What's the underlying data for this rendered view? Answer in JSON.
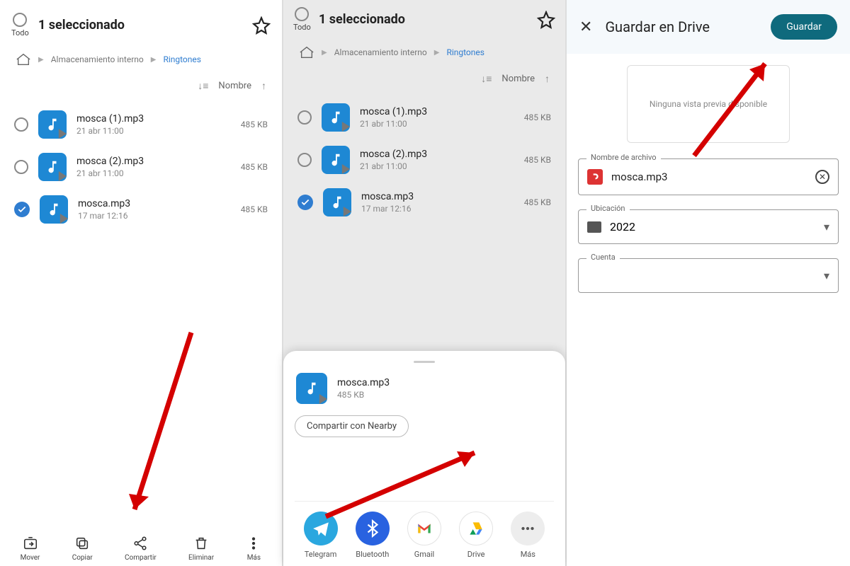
{
  "p1": {
    "todo": "Todo",
    "title": "1 seleccionado",
    "breadcrumb": {
      "root": "Almacenamiento interno",
      "current": "Ringtones"
    },
    "sort": {
      "label": "Nombre"
    },
    "files": [
      {
        "name": "mosca (1).mp3",
        "date": "21 abr 11:00",
        "size": "485 KB",
        "selected": false
      },
      {
        "name": "mosca (2).mp3",
        "date": "21 abr 11:00",
        "size": "485 KB",
        "selected": false
      },
      {
        "name": "mosca.mp3",
        "date": "17 mar 12:16",
        "size": "485 KB",
        "selected": true
      }
    ],
    "actions": {
      "move": "Mover",
      "copy": "Copiar",
      "share": "Compartir",
      "delete": "Eliminar",
      "more": "Más"
    }
  },
  "p2": {
    "todo": "Todo",
    "title": "1 seleccionado",
    "breadcrumb": {
      "root": "Almacenamiento interno",
      "current": "Ringtones"
    },
    "sort": {
      "label": "Nombre"
    },
    "files": [
      {
        "name": "mosca (1).mp3",
        "date": "21 abr 11:00",
        "size": "485 KB",
        "selected": false
      },
      {
        "name": "mosca (2).mp3",
        "date": "21 abr 11:00",
        "size": "485 KB",
        "selected": false
      },
      {
        "name": "mosca.mp3",
        "date": "17 mar 12:16",
        "size": "485 KB",
        "selected": true
      }
    ],
    "share": {
      "file": "mosca.mp3",
      "size": "485 KB",
      "nearby": "Compartir con Nearby"
    },
    "apps": {
      "telegram": "Telegram",
      "bluetooth": "Bluetooth",
      "gmail": "Gmail",
      "drive": "Drive",
      "more": "Más"
    }
  },
  "p3": {
    "title": "Guardar en Drive",
    "save": "Guardar",
    "preview": "Ninguna vista previa disponible",
    "filename": {
      "label": "Nombre de archivo",
      "value": "mosca.mp3"
    },
    "location": {
      "label": "Ubicación",
      "value": "2022"
    },
    "account": {
      "label": "Cuenta",
      "value": ""
    }
  }
}
